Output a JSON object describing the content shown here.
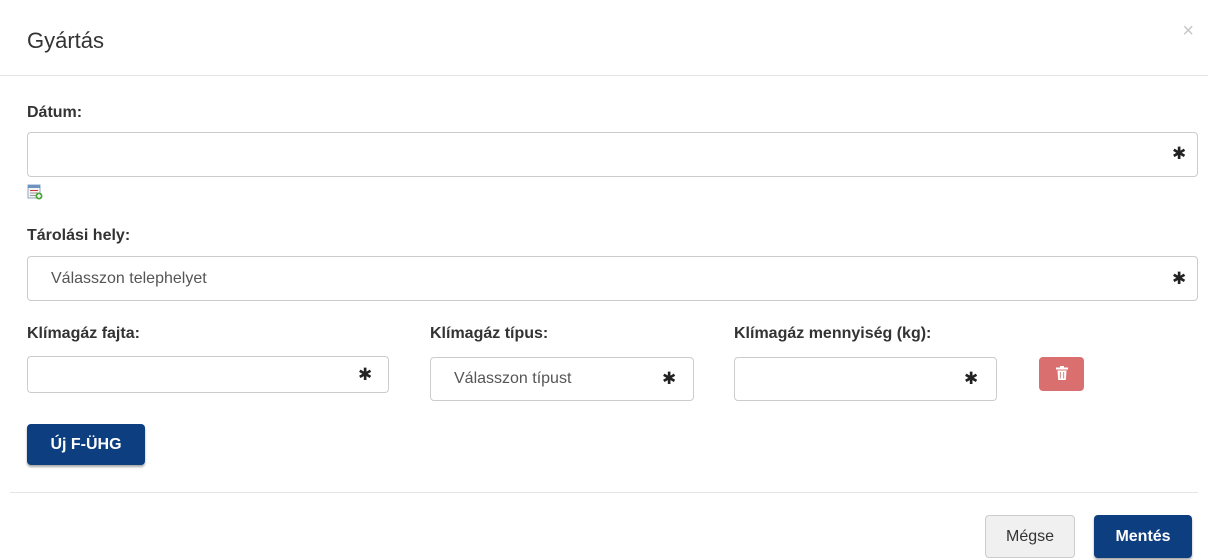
{
  "modal": {
    "title": "Gyártás",
    "close_symbol": "×"
  },
  "form": {
    "date_label": "Dátum:",
    "date_value": "",
    "storage_label": "Tárolási hely:",
    "storage_placeholder": "Válasszon telephelyet",
    "gas_kind_label": "Klímagáz fajta:",
    "gas_kind_value": "",
    "gas_type_label": "Klímagáz típus:",
    "gas_type_placeholder": "Válasszon típust",
    "gas_amount_label": "Klímagáz mennyiség (kg):",
    "gas_amount_value": "",
    "required_marker": "✱"
  },
  "buttons": {
    "new_label": "Új F-ÜHG",
    "cancel_label": "Mégse",
    "save_label": "Mentés"
  },
  "icons": {
    "calendar": "calendar-icon",
    "delete": "trash-icon",
    "close": "close-icon"
  },
  "colors": {
    "primary": "#0d3e80",
    "danger": "#d9706f"
  }
}
